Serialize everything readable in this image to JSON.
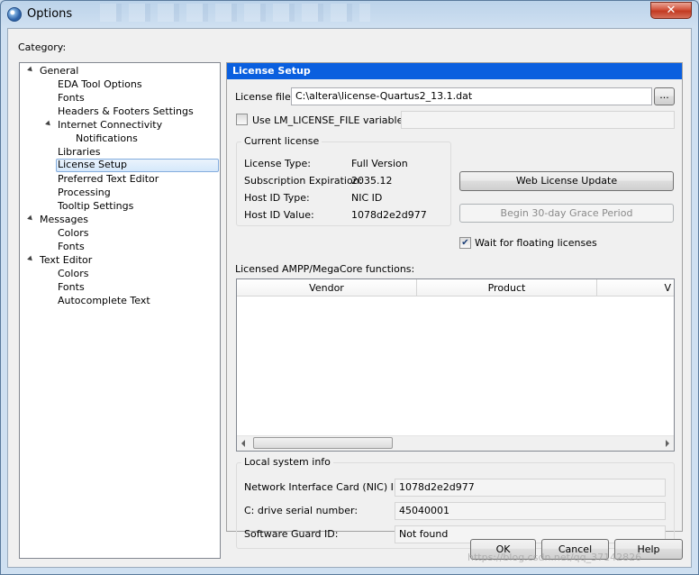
{
  "window": {
    "title": "Options",
    "close_glyph": "✕",
    "app_icon": "options-app-icon"
  },
  "category_label": "Category:",
  "tree": {
    "general": "General",
    "eda_tool_options": "EDA Tool Options",
    "fonts_general": "Fonts",
    "headers_footers": "Headers & Footers Settings",
    "internet_connectivity": "Internet Connectivity",
    "notifications": "Notifications",
    "libraries": "Libraries",
    "license_setup": "License Setup",
    "preferred_text_editor": "Preferred Text Editor",
    "processing": "Processing",
    "tooltip_settings": "Tooltip Settings",
    "messages": "Messages",
    "colors_messages": "Colors",
    "fonts_messages": "Fonts",
    "text_editor": "Text Editor",
    "colors_text_editor": "Colors",
    "fonts_text_editor": "Fonts",
    "autocomplete_text": "Autocomplete Text",
    "selected": "License Setup"
  },
  "panel": {
    "header": "License Setup",
    "license_file_label": "License file:",
    "license_file_value": "C:\\altera\\license-Quartus2_13.1.dat",
    "browse_label": "...",
    "use_lm_label": "Use LM_LICENSE_FILE variable:",
    "use_lm_checked": false,
    "use_lm_value": "",
    "current_license": {
      "title": "Current license",
      "license_type_label": "License Type:",
      "license_type_value": "Full Version",
      "expiration_label": "Subscription Expiration:",
      "expiration_value": "2035.12",
      "host_id_type_label": "Host ID Type:",
      "host_id_type_value": "NIC ID",
      "host_id_value_label": "Host ID Value:",
      "host_id_value_value": "1078d2e2d977"
    },
    "web_license_update_label": "Web License Update",
    "grace_period_label": "Begin 30-day Grace Period",
    "wait_floating_label": "Wait for floating licenses",
    "wait_floating_checked": true,
    "check_glyph": "✔",
    "ampp_label": "Licensed AMPP/MegaCore functions:",
    "table_columns": [
      "Vendor",
      "Product",
      "V"
    ],
    "local_system": {
      "title": "Local system info",
      "nic_label": "Network Interface Card (NIC) ID:",
      "nic_value": "1078d2e2d977",
      "drive_label": "C: drive serial number:",
      "drive_value": "45040001",
      "guard_label": "Software Guard ID:",
      "guard_value": "Not found"
    }
  },
  "buttons": {
    "ok": "OK",
    "cancel": "Cancel",
    "help": "Help"
  },
  "watermark": "https://blog.csdn.net/qq_37142826"
}
